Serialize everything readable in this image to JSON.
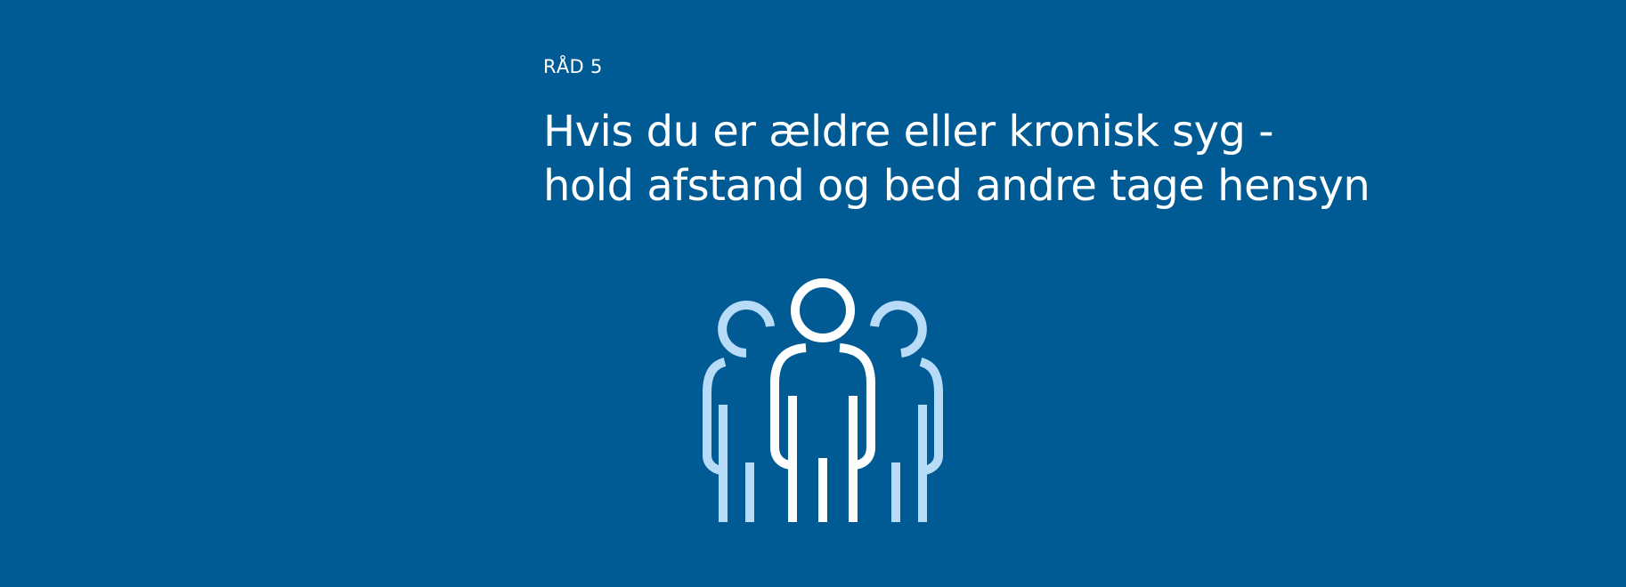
{
  "advice": {
    "label": "RÅD 5",
    "title_line_1": "Hvis du er ældre eller kronisk syg -",
    "title_line_2": "hold afstand og bed andre tage hensyn"
  },
  "icon": {
    "name": "group-of-people-icon"
  },
  "colors": {
    "background": "#005b94",
    "text": "#ffffff",
    "icon_primary": "#ffffff",
    "icon_secondary": "#b8dcf7"
  }
}
